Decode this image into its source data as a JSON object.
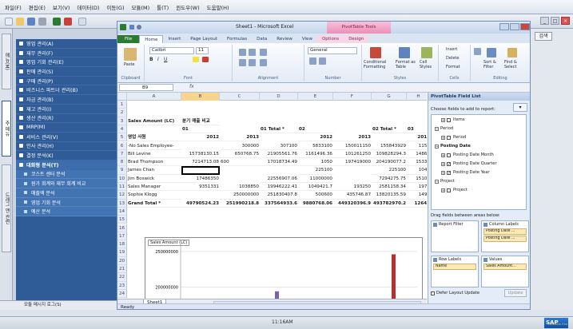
{
  "sap": {
    "menu": [
      "파일(F)",
      "편집(E)",
      "보기(V)",
      "데이터(D)",
      "이동(G)",
      "모듈(M)",
      "툴(T)",
      "윈도우(W)",
      "도움말(H)"
    ],
    "side_tabs": [
      "메뉴(M)",
      "주 메뉴",
      "드래그 앤 관련"
    ],
    "modules": [
      {
        "label": "영업 관리(A)",
        "open": false
      },
      {
        "label": "재무 관리(F)",
        "open": false
      },
      {
        "label": "영업 기회 관리(E)",
        "open": false
      },
      {
        "label": "판매 관리(S)",
        "open": false
      },
      {
        "label": "구매 관리(P)",
        "open": false
      },
      {
        "label": "비즈니스 파트너 관리(B)",
        "open": false
      },
      {
        "label": "자금 관리(B)",
        "open": false
      },
      {
        "label": "재고 관리(I)",
        "open": false
      },
      {
        "label": "생산 관리(R)",
        "open": false
      },
      {
        "label": "MRP(M)",
        "open": false
      },
      {
        "label": "서비스 관리(V)",
        "open": false
      },
      {
        "label": "인사 관리(H)",
        "open": false
      },
      {
        "label": "결정 분석(K)",
        "open": false
      },
      {
        "label": "대화형 분석(T)",
        "open": true
      }
    ],
    "submodules": [
      "코스트 센터 분석",
      "원가 회계와 재무 회계 비교",
      "매출액 분석",
      "영업 기회 분석",
      "예산 분석"
    ],
    "bottom_left": "모듈 메시지 로그(S)",
    "find_button": "검색",
    "clock": "11:16AM",
    "logo": "SAP",
    "logo_sub": "Business One"
  },
  "excel": {
    "title": "Sheet1 - Microsoft Excel",
    "context_tab": "PivotTable Tools",
    "tabs": [
      "File",
      "Home",
      "Insert",
      "Page Layout",
      "Formulas",
      "Data",
      "Review",
      "View",
      "Options",
      "Design"
    ],
    "ribbon": {
      "paste": "Paste",
      "font_name": "Calibri",
      "font_size": "11",
      "number_format": "General",
      "conditional_formatting": "Conditional Formatting",
      "format_as_table": "Format as Table",
      "cell_styles": "Cell Styles",
      "insert": "Insert",
      "delete": "Delete",
      "format": "Format",
      "sort_filter": "Sort & Filter",
      "find_select": "Find & Select",
      "groups": [
        "Clipboard",
        "Font",
        "Alignment",
        "Number",
        "Styles",
        "Cells",
        "Editing"
      ]
    },
    "name_box": "B9",
    "fx": "fx",
    "columns": [
      "A",
      "B",
      "C",
      "D",
      "E",
      "F",
      "G",
      "H"
    ],
    "selected_column": "B",
    "rows": [
      {
        "n": "1",
        "cells": [
          "",
          "",
          "",
          "",
          "",
          "",
          "",
          ""
        ]
      },
      {
        "n": "2",
        "cells": [
          "",
          "",
          "",
          "",
          "",
          "",
          "",
          ""
        ]
      },
      {
        "n": "3",
        "cells": [
          "Sales Amount (LC)",
          "분기 매출 비교",
          "",
          "",
          "",
          "",
          "",
          ""
        ]
      },
      {
        "n": "4",
        "cells": [
          "",
          "01",
          "",
          "01 Total *",
          "02",
          "",
          "02 Total *",
          "03"
        ]
      },
      {
        "n": "5",
        "cells": [
          "영업 사원",
          "2012",
          "2013",
          "",
          "2012",
          "2013",
          "",
          "2012"
        ]
      },
      {
        "n": "6",
        "cells": [
          "-No Sales Employee-",
          "",
          "300000",
          "307100",
          "5833100",
          "150011150",
          "155843929",
          "1151"
        ]
      },
      {
        "n": "7",
        "cells": [
          "Bill Levine",
          "15738130.15",
          "650768.75",
          "21905561.76",
          "1161496.36",
          "101261250",
          "109828294.3",
          "14865"
        ]
      },
      {
        "n": "8",
        "cells": [
          "Brad Thompson",
          "7214713.08",
          "600",
          "17018734.49",
          "1050",
          "197419000",
          "204190077.2",
          "15337"
        ]
      },
      {
        "n": "9",
        "cells": [
          "James Chan",
          "",
          "",
          "",
          "225100",
          "",
          "225100",
          "1044"
        ]
      },
      {
        "n": "10",
        "cells": [
          "Jim Boswick",
          "17486350",
          "",
          "22556907.06",
          "11000000",
          "",
          "7294275.75",
          "15107"
        ]
      },
      {
        "n": "11",
        "cells": [
          "Sales Manager",
          "9351331",
          "1038850",
          "19946222.41",
          "1049421.7",
          "193250",
          "2581158.34",
          "1974"
        ]
      },
      {
        "n": "12",
        "cells": [
          "Sophie Klogg",
          "",
          "250000000",
          "251830407.8",
          "500600",
          "435746.87",
          "13820135.59",
          "1498"
        ]
      },
      {
        "n": "13",
        "cells": [
          "Grand Total *",
          "49790524.23",
          "251990218.8",
          "337564933.6",
          "9880768.06",
          "449320396.9",
          "493782970.2",
          "12647"
        ]
      },
      {
        "n": "14",
        "cells": [
          "",
          "",
          "",
          "",
          "",
          "",
          "",
          ""
        ]
      },
      {
        "n": "15",
        "cells": [
          "",
          "",
          "",
          "",
          "",
          "",
          "",
          ""
        ]
      },
      {
        "n": "16",
        "cells": [
          "",
          "",
          "",
          "",
          "",
          "",
          "",
          ""
        ]
      },
      {
        "n": "17",
        "cells": [
          "",
          "",
          "",
          "",
          "",
          "",
          "",
          ""
        ]
      },
      {
        "n": "18",
        "cells": [
          "",
          "",
          "",
          "",
          "",
          "",
          "",
          ""
        ]
      },
      {
        "n": "19",
        "cells": [
          "",
          "",
          "",
          "",
          "",
          "",
          "",
          ""
        ]
      },
      {
        "n": "20",
        "cells": [
          "",
          "",
          "",
          "",
          "",
          "",
          "",
          ""
        ]
      },
      {
        "n": "21",
        "cells": [
          "",
          "",
          "",
          "",
          "",
          "",
          "",
          ""
        ]
      },
      {
        "n": "22",
        "cells": [
          "",
          "",
          "",
          "",
          "",
          "",
          "",
          ""
        ]
      },
      {
        "n": "23",
        "cells": [
          "",
          "",
          "",
          "",
          "",
          "",
          "",
          ""
        ]
      },
      {
        "n": "24",
        "cells": [
          "",
          "",
          "",
          "",
          "",
          "",
          "",
          ""
        ]
      }
    ],
    "sheet_tab": "Sheet1",
    "status": "Ready"
  },
  "pivot_field_list": {
    "title": "PivotTable Field List",
    "choose_label": "Choose fields to add to report:",
    "fields": [
      {
        "label": "Items",
        "type": "sub"
      },
      {
        "label": "Period",
        "type": "group"
      },
      {
        "label": "Period",
        "type": "sub"
      },
      {
        "label": "Posting Date",
        "type": "group-bold"
      },
      {
        "label": "Posting Date Month",
        "type": "sub"
      },
      {
        "label": "Posting Date Quarter",
        "type": "sub-checked"
      },
      {
        "label": "Posting Date Year",
        "type": "sub-checked"
      },
      {
        "label": "Project",
        "type": "group"
      },
      {
        "label": "Project",
        "type": "sub"
      }
    ],
    "drag_label": "Drag fields between areas below:",
    "areas": {
      "report_filter": {
        "label": "Report Filter",
        "items": []
      },
      "column_labels": {
        "label": "Column Labels",
        "items": [
          "Posting Date ...",
          "Posting Date ..."
        ]
      },
      "row_labels": {
        "label": "Row Labels",
        "items": [
          "Name"
        ]
      },
      "values": {
        "label": "Values",
        "items": [
          "Sales Amount..."
        ]
      }
    },
    "defer_label": "Defer Layout Update",
    "update_button": "Update"
  },
  "chart_data": {
    "type": "bar",
    "title": "Sales Amount (LC)",
    "ylim": [
      150000000,
      260000000
    ],
    "yticks": [
      "250000000",
      "200000000",
      "150000000"
    ],
    "series": [
      {
        "name": "",
        "color": "#4a74b8",
        "values": [
          151000000
        ]
      },
      {
        "name": "",
        "color": "#7b62a8",
        "values": [
          194000000
        ]
      },
      {
        "name": "",
        "color": "#b7302f",
        "values": [
          246000000
        ]
      }
    ]
  },
  "colors": {
    "sap_nav": "#2f5b97",
    "excel_file_tab": "#2d7a33",
    "context_tab": "#eb8fb7",
    "bar_blue": "#4a74b8",
    "bar_purple": "#7b62a8",
    "bar_red": "#b7302f"
  }
}
